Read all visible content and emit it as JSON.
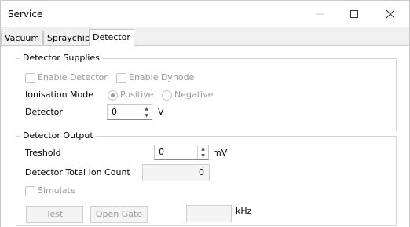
{
  "window": {
    "title": "Service"
  },
  "tabs": [
    {
      "label": "Vacuum"
    },
    {
      "label": "Spraychip"
    },
    {
      "label": "Detector"
    }
  ],
  "detector_supplies": {
    "title": "Detector Supplies",
    "enable_detector": "Enable Detector",
    "enable_dynode": "Enable Dynode",
    "ionisation_mode_label": "Ionisation Mode",
    "positive": "Positive",
    "negative": "Negative",
    "detector_label": "Detector",
    "detector_value": "0",
    "detector_unit": "V"
  },
  "detector_output": {
    "title": "Detector Output",
    "treshold_label": "Treshold",
    "treshold_value": "0",
    "treshold_unit": "mV",
    "total_ion_count_label": "Detector Total Ion Count",
    "total_ion_count_value": "0",
    "simulate": "Simulate",
    "test_button": "Test",
    "open_gate_button": "Open Gate",
    "frequency_value": "",
    "frequency_unit": "kHz"
  }
}
